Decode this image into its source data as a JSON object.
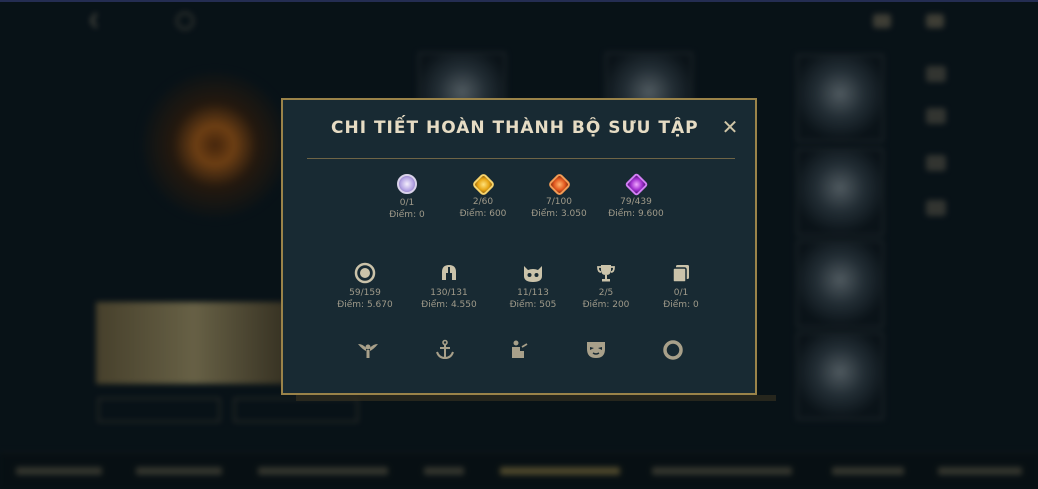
{
  "modal": {
    "title": "CHI TIẾT HOÀN THÀNH BỘ SƯU TẬP",
    "close_symbol": "✕",
    "gems": [
      {
        "icon": "white-gem-icon",
        "count": "0/1",
        "points": "Điểm: 0"
      },
      {
        "icon": "gold-gem-icon",
        "count": "2/60",
        "points": "Điểm: 600"
      },
      {
        "icon": "orange-gem-icon",
        "count": "7/100",
        "points": "Điểm: 3.050"
      },
      {
        "icon": "purple-gem-icon",
        "count": "79/439",
        "points": "Điểm: 9.600"
      }
    ],
    "categories": [
      {
        "icon": "ring-emblem-icon",
        "count": "59/159",
        "points": "Điểm: 5.670"
      },
      {
        "icon": "helmet-icon",
        "count": "130/131",
        "points": "Điểm: 4.550"
      },
      {
        "icon": "creature-face-icon",
        "count": "11/113",
        "points": "Điểm: 505"
      },
      {
        "icon": "trophy-icon",
        "count": "2/5",
        "points": "Điểm: 200"
      },
      {
        "icon": "cards-icon",
        "count": "0/1",
        "points": "Điểm: 0"
      }
    ],
    "bottom_icons": [
      "winged-emblem-icon",
      "anchor-icon",
      "podium-icon",
      "mask-icon",
      "ring-icon"
    ]
  },
  "colors": {
    "modal_bg": "#182a33",
    "modal_border": "#9a8349",
    "title_text": "#e6dcc4",
    "stat_text": "#9f9a8a"
  }
}
